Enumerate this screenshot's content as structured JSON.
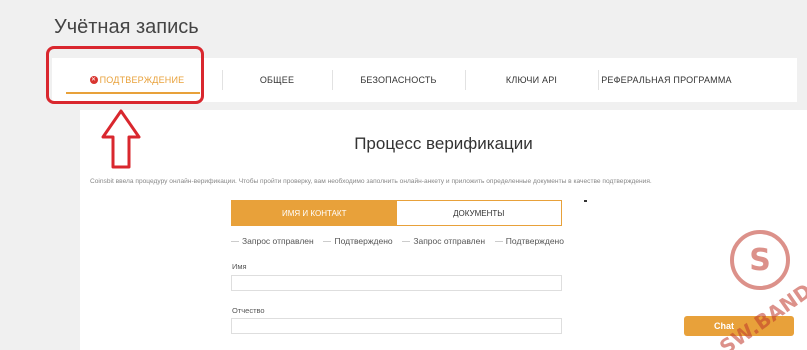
{
  "page": {
    "title": "Учётная запись"
  },
  "tabs": [
    {
      "label": "ПОДТВЕРЖДЕНИЕ",
      "active": true
    },
    {
      "label": "ОБЩЕЕ"
    },
    {
      "label": "БЕЗОПАСНОСТЬ"
    },
    {
      "label": "КЛЮЧИ API"
    },
    {
      "label": "РЕФЕРАЛЬНАЯ ПРОГРАММА"
    }
  ],
  "verification": {
    "title": "Процесс верификации",
    "description": "Coinsbit ввела процедуру онлайн-верификации. Чтобы пройти проверку, вам необходимо заполнить онлайн-анкету и приложить определенные документы в качестве подтверждения.",
    "subtabs": [
      {
        "label": "ИМЯ И КОНТАКТ",
        "active": true
      },
      {
        "label": "ДОКУМЕНТЫ"
      }
    ],
    "statuses": [
      "Запрос отправлен",
      "Подтверждено",
      "Запрос отправлен",
      "Подтверждено"
    ],
    "fields": [
      {
        "label": "Имя",
        "value": ""
      },
      {
        "label": "Отчество",
        "value": ""
      }
    ]
  },
  "chat": {
    "label": "Chat"
  },
  "watermark": {
    "text": "SW.BAND"
  },
  "colors": {
    "accent": "#e8a13a",
    "annotation": "#d9272e",
    "error": "#d8342f"
  },
  "icons": {
    "active_tab": "x-circle-icon",
    "annotation": "up-arrow-icon"
  }
}
